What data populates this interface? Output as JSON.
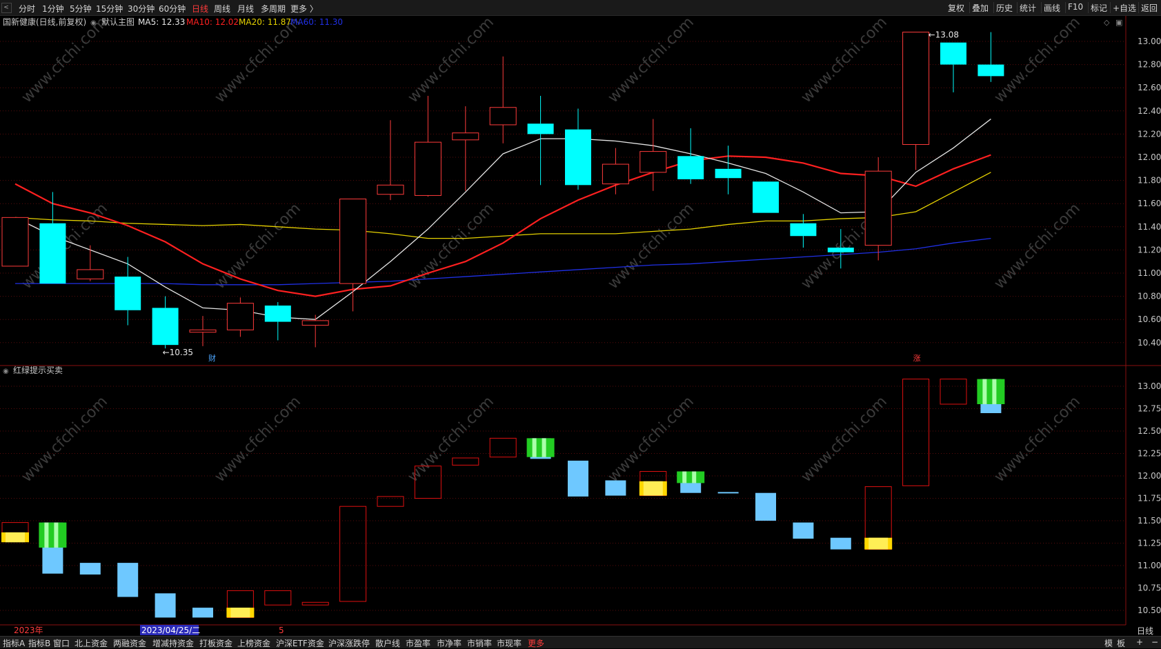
{
  "toolbar": {
    "periods": [
      "分时",
      "1分钟",
      "5分钟",
      "15分钟",
      "30分钟",
      "60分钟",
      "日线",
      "周线",
      "月线",
      "多周期",
      "更多 〉"
    ],
    "active_period": "日线",
    "right_items": [
      "复权",
      "叠加",
      "历史",
      "统计",
      "画线",
      "F10",
      "标记",
      "+自选",
      "返回"
    ]
  },
  "main_panel": {
    "stock_name": "国新健康(日线,前复权)",
    "indicator_name": "默认主图",
    "ma5_label": "MA5: 12.33",
    "ma10_label": "MA10: 12.02",
    "ma20_label": "MA20: 11.87",
    "ma60_label": "MA60: 11.30",
    "high_marker": "13.08",
    "low_marker": "10.35",
    "event_cai": "财",
    "event_zhang": "涨",
    "colors": {
      "ma5": "#e6e6e6",
      "ma10": "#ff2020",
      "ma20": "#e6d200",
      "ma60": "#2030e6",
      "up": "#ff3b3b",
      "down": "#00ffff"
    }
  },
  "sub_panel": {
    "indicator_name": "红绿提示买卖"
  },
  "bottom_axis": {
    "year_label": "2023年",
    "date_cursor": "2023/04/25/二",
    "tick_5": "5",
    "period_label": "日线"
  },
  "bottom_tabs": [
    "指标A",
    "指标B",
    "窗口",
    "北上资金",
    "两融资金",
    "增减持资金",
    "打板资金",
    "上榜资金",
    "沪深ETF资金",
    "沪深涨跌停",
    "散户线",
    "市盈率",
    "市净率",
    "市销率",
    "市现率",
    "更多"
  ],
  "bottom_right": [
    "模",
    "板",
    "+",
    "−"
  ],
  "watermark": "www.cfchi.com",
  "chart_data": {
    "type": "candlestick",
    "y_ticks_main": [
      13.0,
      12.8,
      12.6,
      12.4,
      12.2,
      12.0,
      11.8,
      11.6,
      11.4,
      11.2,
      11.0,
      10.8,
      10.6,
      10.4
    ],
    "y_ticks_sub": [
      13.0,
      12.75,
      12.5,
      12.25,
      12.0,
      11.75,
      11.5,
      11.25,
      11.0,
      10.75,
      10.5
    ],
    "candles": [
      {
        "o": 11.06,
        "c": 11.48,
        "h": 11.48,
        "l": 11.06
      },
      {
        "o": 11.43,
        "c": 10.91,
        "h": 11.7,
        "l": 10.91
      },
      {
        "o": 10.95,
        "c": 11.03,
        "h": 11.24,
        "l": 10.93
      },
      {
        "o": 10.97,
        "c": 10.68,
        "h": 11.14,
        "l": 10.55
      },
      {
        "o": 10.7,
        "c": 10.38,
        "h": 10.8,
        "l": 10.35
      },
      {
        "o": 10.49,
        "c": 10.51,
        "h": 10.63,
        "l": 10.37
      },
      {
        "o": 10.51,
        "c": 10.74,
        "h": 10.79,
        "l": 10.45
      },
      {
        "o": 10.72,
        "c": 10.58,
        "h": 10.75,
        "l": 10.42
      },
      {
        "o": 10.55,
        "c": 10.59,
        "h": 10.64,
        "l": 10.36
      },
      {
        "o": 10.91,
        "c": 11.64,
        "h": 11.64,
        "l": 10.67
      },
      {
        "o": 11.68,
        "c": 11.76,
        "h": 12.32,
        "l": 11.63
      },
      {
        "o": 11.67,
        "c": 12.13,
        "h": 12.53,
        "l": 11.66
      },
      {
        "o": 12.15,
        "c": 12.21,
        "h": 12.44,
        "l": 11.71
      },
      {
        "o": 12.28,
        "c": 12.43,
        "h": 12.87,
        "l": 12.12
      },
      {
        "o": 12.29,
        "c": 12.2,
        "h": 12.53,
        "l": 11.76
      },
      {
        "o": 12.24,
        "c": 11.76,
        "h": 12.42,
        "l": 11.72
      },
      {
        "o": 11.77,
        "c": 11.94,
        "h": 12.08,
        "l": 11.68
      },
      {
        "o": 11.87,
        "c": 12.05,
        "h": 12.33,
        "l": 11.71
      },
      {
        "o": 12.01,
        "c": 11.81,
        "h": 12.25,
        "l": 11.77
      },
      {
        "o": 11.9,
        "c": 11.82,
        "h": 12.1,
        "l": 11.68
      },
      {
        "o": 11.79,
        "c": 11.52,
        "h": 11.79,
        "l": 11.52
      },
      {
        "o": 11.43,
        "c": 11.32,
        "h": 11.51,
        "l": 11.22
      },
      {
        "o": 11.22,
        "c": 11.18,
        "h": 11.38,
        "l": 11.04
      },
      {
        "o": 11.24,
        "c": 11.88,
        "h": 12.0,
        "l": 11.11
      },
      {
        "o": 12.11,
        "c": 13.08,
        "h": 13.08,
        "l": 11.89
      },
      {
        "o": 12.99,
        "c": 12.8,
        "h": 12.99,
        "l": 12.56
      },
      {
        "o": 12.8,
        "c": 12.7,
        "h": 13.08,
        "l": 12.65
      }
    ],
    "ma5": [
      11.48,
      11.32,
      11.2,
      11.08,
      10.88,
      10.7,
      10.68,
      10.62,
      10.6,
      10.84,
      11.1,
      11.38,
      11.7,
      12.03,
      12.16,
      12.16,
      12.14,
      12.1,
      12.03,
      11.95,
      11.86,
      11.7,
      11.52,
      11.53,
      11.87,
      12.08,
      12.33
    ],
    "ma10": [
      11.77,
      11.6,
      11.52,
      11.41,
      11.27,
      11.08,
      10.95,
      10.85,
      10.8,
      10.86,
      10.89,
      11.0,
      11.1,
      11.26,
      11.47,
      11.63,
      11.76,
      11.87,
      11.97,
      12.01,
      12.0,
      11.95,
      11.86,
      11.84,
      11.75,
      11.9,
      12.02
    ],
    "ma20": [
      11.48,
      11.46,
      11.45,
      11.43,
      11.42,
      11.41,
      11.42,
      11.4,
      11.38,
      11.37,
      11.34,
      11.3,
      11.3,
      11.32,
      11.34,
      11.34,
      11.34,
      11.36,
      11.38,
      11.42,
      11.45,
      11.45,
      11.47,
      11.48,
      11.53,
      11.7,
      11.87
    ],
    "ma60": [
      10.91,
      10.91,
      10.91,
      10.91,
      10.91,
      10.9,
      10.9,
      10.9,
      10.91,
      10.92,
      10.93,
      10.95,
      10.97,
      10.99,
      11.01,
      11.03,
      11.05,
      11.07,
      11.08,
      11.1,
      11.12,
      11.14,
      11.16,
      11.18,
      11.21,
      11.26,
      11.3
    ],
    "sub_bars": [
      {
        "t": "up",
        "top": 11.48,
        "bot": 11.3,
        "mark": "yellow",
        "mtop": 11.37,
        "mbot": 11.26
      },
      {
        "t": "down",
        "top": 11.48,
        "bot": 10.91,
        "mark": "green",
        "mtop": 11.48,
        "mbot": 11.2
      },
      {
        "t": "down",
        "top": 11.03,
        "bot": 10.9
      },
      {
        "t": "down",
        "top": 11.03,
        "bot": 10.65
      },
      {
        "t": "down",
        "top": 10.69,
        "bot": 10.42
      },
      {
        "t": "down",
        "top": 10.53,
        "bot": 10.42
      },
      {
        "t": "up",
        "top": 10.72,
        "bot": 10.42,
        "mark": "yellow",
        "mtop": 10.53,
        "mbot": 10.42
      },
      {
        "t": "up",
        "top": 10.72,
        "bot": 10.56
      },
      {
        "t": "up",
        "top": 10.59,
        "bot": 10.56
      },
      {
        "t": "up",
        "top": 11.66,
        "bot": 10.6
      },
      {
        "t": "up",
        "top": 11.77,
        "bot": 11.66
      },
      {
        "t": "up",
        "top": 12.11,
        "bot": 11.75
      },
      {
        "t": "up",
        "top": 12.2,
        "bot": 12.12
      },
      {
        "t": "up",
        "top": 12.42,
        "bot": 12.21
      },
      {
        "t": "down",
        "top": 12.42,
        "bot": 12.19,
        "mark": "green",
        "mtop": 12.42,
        "mbot": 12.21
      },
      {
        "t": "down",
        "top": 12.17,
        "bot": 11.77
      },
      {
        "t": "down",
        "top": 11.95,
        "bot": 11.78
      },
      {
        "t": "up",
        "top": 12.05,
        "bot": 11.78,
        "mark": "yellow",
        "mtop": 11.94,
        "mbot": 11.78
      },
      {
        "t": "down",
        "top": 12.05,
        "bot": 11.81,
        "mark": "green",
        "mtop": 12.05,
        "mbot": 11.92
      },
      {
        "t": "down",
        "top": 11.82,
        "bot": 11.81
      },
      {
        "t": "down",
        "top": 11.81,
        "bot": 11.5
      },
      {
        "t": "down",
        "top": 11.48,
        "bot": 11.3
      },
      {
        "t": "down",
        "top": 11.31,
        "bot": 11.18
      },
      {
        "t": "up",
        "top": 11.88,
        "bot": 11.18,
        "mark": "yellow",
        "mtop": 11.31,
        "mbot": 11.18
      },
      {
        "t": "up",
        "top": 13.08,
        "bot": 11.89
      },
      {
        "t": "up",
        "top": 13.08,
        "bot": 12.8
      },
      {
        "t": "down",
        "top": 13.08,
        "bot": 12.7,
        "mark": "green",
        "mtop": 13.08,
        "mbot": 12.8
      }
    ]
  }
}
